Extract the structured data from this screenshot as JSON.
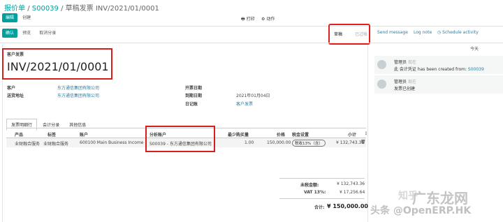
{
  "breadcrumb": {
    "root": "报价单",
    "sep1": "/",
    "order": "S00039",
    "sep2": "/",
    "current": "草稿发票 INV/2021/01/0001"
  },
  "toolbar": {
    "edit": "编辑",
    "create": "创建",
    "print": "打印",
    "action": "动作"
  },
  "actionbar": {
    "confirm": "确认",
    "preview": "预览",
    "cancel_entry": "取消分录"
  },
  "status": {
    "draft": "草稿",
    "posted": "已过帐"
  },
  "chatter_actions": {
    "send_message": "Send message",
    "log_note": "Log note",
    "schedule": "Schedule activity"
  },
  "chatter": {
    "today": "今天",
    "messages": [
      {
        "author": "管理员",
        "time": "现在",
        "prefix": "此 会计凭证 has been created from:",
        "link": "S00039"
      },
      {
        "author": "管理员",
        "time": "现在",
        "text": "发票已创建"
      }
    ]
  },
  "invoice": {
    "type_label": "客户发票",
    "number": "INV/2021/01/0001",
    "customer_label": "客户",
    "customer": "东方通信集团有限公司",
    "delivery_label": "送货地址",
    "delivery": "东方通信集团有限公司",
    "invoice_date_label": "开票日期",
    "due_date_label": "到期日期",
    "due_date": "2021年01月04日",
    "journal_label": "日记账",
    "journal": "客户发票"
  },
  "tabs": [
    "发票明细行",
    "会计分录",
    "其他信息"
  ],
  "lines": {
    "headers": [
      "产品",
      "标签",
      "账户",
      "分析账户",
      "最少购买量",
      "价格",
      "税金设置",
      "小计"
    ],
    "rows": [
      {
        "product": "业财融合服务",
        "label": "业财融合服务",
        "account": "600100 Main Business Income",
        "analytic": "S00039 - 东方通信集团有限公司",
        "qty": "1.00",
        "price": "150,000.00",
        "tax": "税收13%（含）",
        "subtotal": "¥ 132,743.36"
      }
    ]
  },
  "totals": {
    "untaxed_label": "未税金额:",
    "untaxed": "¥ 132,743.36",
    "vat_label": "VAT 13%:",
    "vat": "¥ 17,256.64",
    "total_label": "合计:",
    "total": "¥ 150,000.00"
  },
  "watermark": {
    "line1": "头条 @OpenERP.HK",
    "line2": "广东龙网",
    "faded": "知乎"
  },
  "colors": {
    "accent": "#00a09d",
    "highlight": "#d91c1c"
  }
}
